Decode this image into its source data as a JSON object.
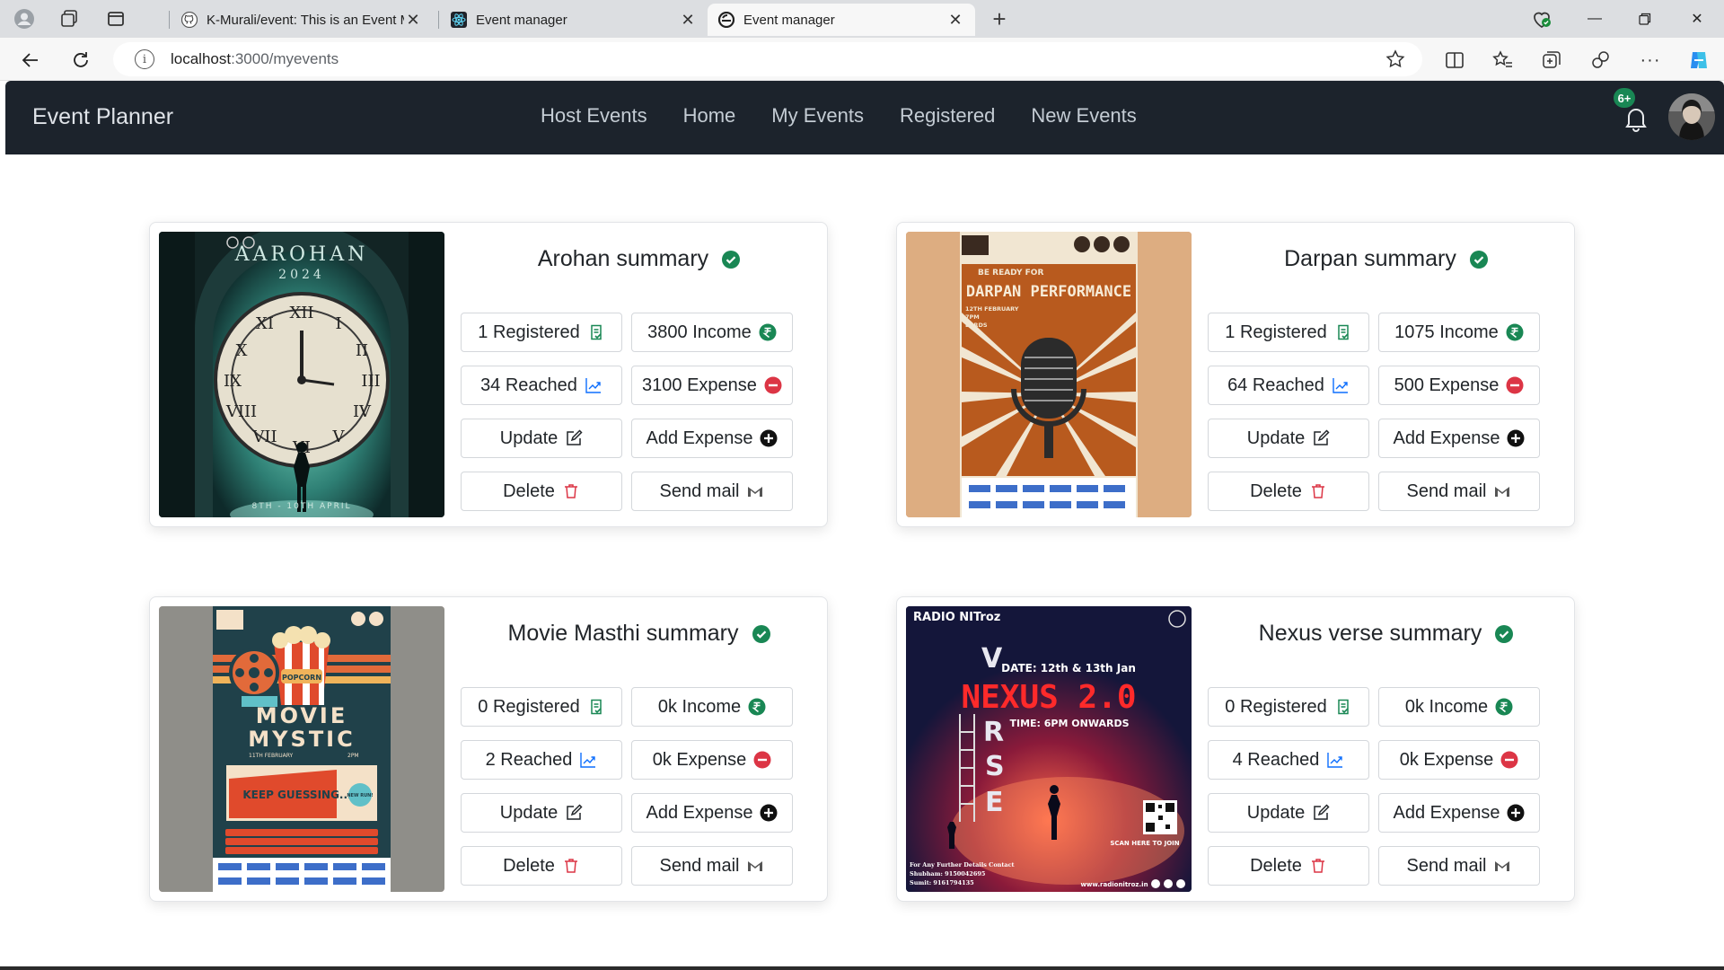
{
  "browser": {
    "tabs": [
      {
        "title": "K-Murali/event: This is an Event Management",
        "icon": "github-icon"
      },
      {
        "title": "Event manager",
        "icon": "react-icon"
      },
      {
        "title": "Event manager",
        "icon": "edge-icon",
        "active": true
      }
    ],
    "url": {
      "host": "localhost",
      "path": ":3000/myevents"
    }
  },
  "app": {
    "brand": "Event Planner",
    "nav": [
      "Host Events",
      "Home",
      "My Events",
      "Registered",
      "New Events"
    ],
    "notifications_badge": "6+"
  },
  "events": [
    {
      "title": "Arohan summary",
      "registered": "1 Registered",
      "income": "3800 Income",
      "reached": "34 Reached",
      "expense": "3100 Expense",
      "update": "Update",
      "add_expense": "Add Expense",
      "delete": "Delete",
      "send_mail": "Send mail",
      "poster": {
        "title": "AAROHAN",
        "year": "2024",
        "date": "8TH - 10TH APRIL"
      }
    },
    {
      "title": "Darpan summary",
      "registered": "1 Registered",
      "income": "1075 Income",
      "reached": "64 Reached",
      "expense": "500 Expense",
      "update": "Update",
      "add_expense": "Add Expense",
      "delete": "Delete",
      "send_mail": "Send mail",
      "poster": {
        "kicker": "BE READY FOR",
        "title": "DARPAN PERFORMANCE",
        "date": "12TH FEBRUARY",
        "time": "7PM",
        "venue": "LORDS"
      }
    },
    {
      "title": "Movie Masthi summary",
      "registered": "0 Registered",
      "income": "0k Income",
      "reached": "2 Reached",
      "expense": "0k Expense",
      "update": "Update",
      "add_expense": "Add Expense",
      "delete": "Delete",
      "send_mail": "Send mail",
      "poster": {
        "title_line1": "MOVIE",
        "title_line2": "MYSTIC",
        "date": "11TH FEBRUARY",
        "time": "2PM",
        "tagline": "KEEP GUESSING...",
        "badge": "NEW RUN!",
        "popcorn": "POPCORN"
      }
    },
    {
      "title": "Nexus verse summary",
      "registered": "0 Registered",
      "income": "0k Income",
      "reached": "4 Reached",
      "expense": "0k Expense",
      "update": "Update",
      "add_expense": "Add Expense",
      "delete": "Delete",
      "send_mail": "Send mail",
      "poster": {
        "org": "RADIO NITroz",
        "date": "DATE: 12th & 13th Jan",
        "title": "NEXUS 2.0",
        "time": "TIME: 6PM ONWARDS",
        "scan": "SCAN HERE TO JOIN",
        "verse": "VERSE",
        "contact_heading": "For Any Further Details Contact",
        "contact1": "Shubham: 9150042695",
        "contact2": "Sumit: 9161794135",
        "website": "www.radionitroz.in"
      }
    }
  ],
  "colors": {
    "navbar": "#1c232c",
    "success": "#198754",
    "danger": "#dc3545",
    "link": "#0d6efd"
  }
}
